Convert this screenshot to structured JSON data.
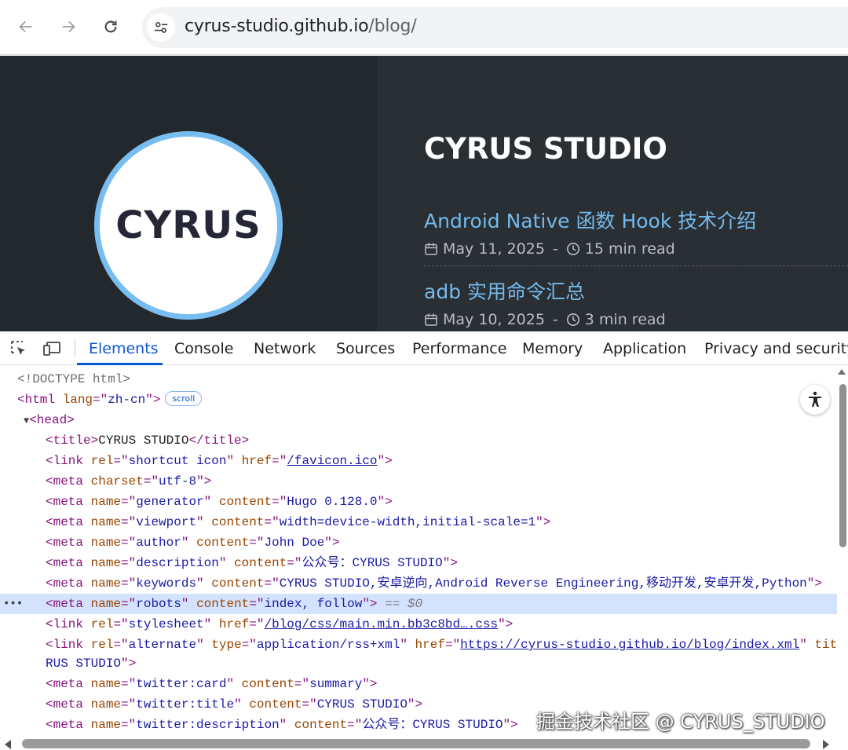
{
  "browser": {
    "url_host": "cyrus-studio.github.io",
    "url_path": "/blog/"
  },
  "page": {
    "logo_text": "CYRUS",
    "site_title": "CYRUS STUDIO",
    "posts": [
      {
        "title": "Android Native 函数 Hook 技术介绍",
        "date": "May 11, 2025",
        "sep": "-",
        "read_time": "15 min read"
      },
      {
        "title": "adb 实用命令汇总",
        "date": "May 10, 2025",
        "sep": "-",
        "read_time": "3 min read"
      }
    ]
  },
  "devtools": {
    "tabs": [
      "Elements",
      "Console",
      "Network",
      "Sources",
      "Performance",
      "Memory",
      "Application",
      "Privacy and security"
    ],
    "active_tab": "Elements",
    "scroll_badge": "scroll",
    "selected_marker": "== $0",
    "ellipsis": "•••",
    "accent_color": "#0b57d0"
  },
  "watermark": "掘金技术社区 @ CYRUS_STUDIO"
}
